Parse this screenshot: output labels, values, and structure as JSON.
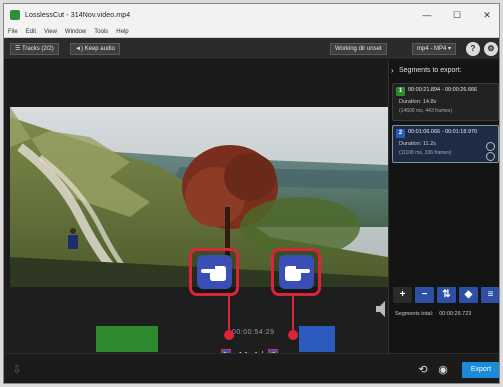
{
  "window": {
    "title": "LosslessCut - 314Nov.video.mp4",
    "controls": [
      "—",
      "☐",
      "✕"
    ]
  },
  "menu": [
    "File",
    "Edit",
    "View",
    "Window",
    "Tools",
    "Help"
  ],
  "toolbar": {
    "tracks_label": "☰ Tracks (2/2)",
    "audio_label": "◄) Keep audio",
    "working_dir_label": "Working dir unset",
    "format_label": "mp4 - MP4 ▾",
    "help_icon": "?",
    "settings_icon": "⚙"
  },
  "panel": {
    "header": "Segments to export:",
    "segments": [
      {
        "num": "1",
        "color": "#2e8a2e",
        "time": "00:00:21.894 - 00:00:26.666",
        "duration": "Duration: 14.8s",
        "info": "(14600 ms, 443 frames)"
      },
      {
        "num": "2",
        "color": "#2d5bbd",
        "time": "00:01:06.066 - 00:01:18.970",
        "duration": "Duration: 11.2s",
        "info": "(11108 ms, 336 frames)"
      }
    ],
    "actions": [
      {
        "icon": "plus-icon",
        "glyph": "+",
        "color": "#2a2a2a"
      },
      {
        "icon": "minus-icon",
        "glyph": "−",
        "color": "#2d4fa5"
      },
      {
        "icon": "reorder-icon",
        "glyph": "⇅",
        "color": "#2d4fa5"
      },
      {
        "icon": "tag-icon",
        "glyph": "◆",
        "color": "#2d4fa5"
      },
      {
        "icon": "list-icon",
        "glyph": "≡",
        "color": "#2d4fa5"
      }
    ],
    "total_label": "Segments total:",
    "total_value": "00:00:26.723"
  },
  "timeline": {
    "time_display": "00:00:54:29",
    "controls": [
      "⇤",
      "◀",
      "▶",
      "▶|",
      "⇥"
    ]
  },
  "callouts": [
    {
      "name": "set-start-callout",
      "icon": "pointing-left-hand-icon"
    },
    {
      "name": "set-end-callout",
      "icon": "pointing-right-hand-icon"
    }
  ],
  "bottom": {
    "export_label": "Export",
    "colors": {
      "accent": "#1c8bd8",
      "highlight": "#d9243a",
      "segment1": "#2e8a2e",
      "segment2": "#2d5bbd"
    }
  }
}
